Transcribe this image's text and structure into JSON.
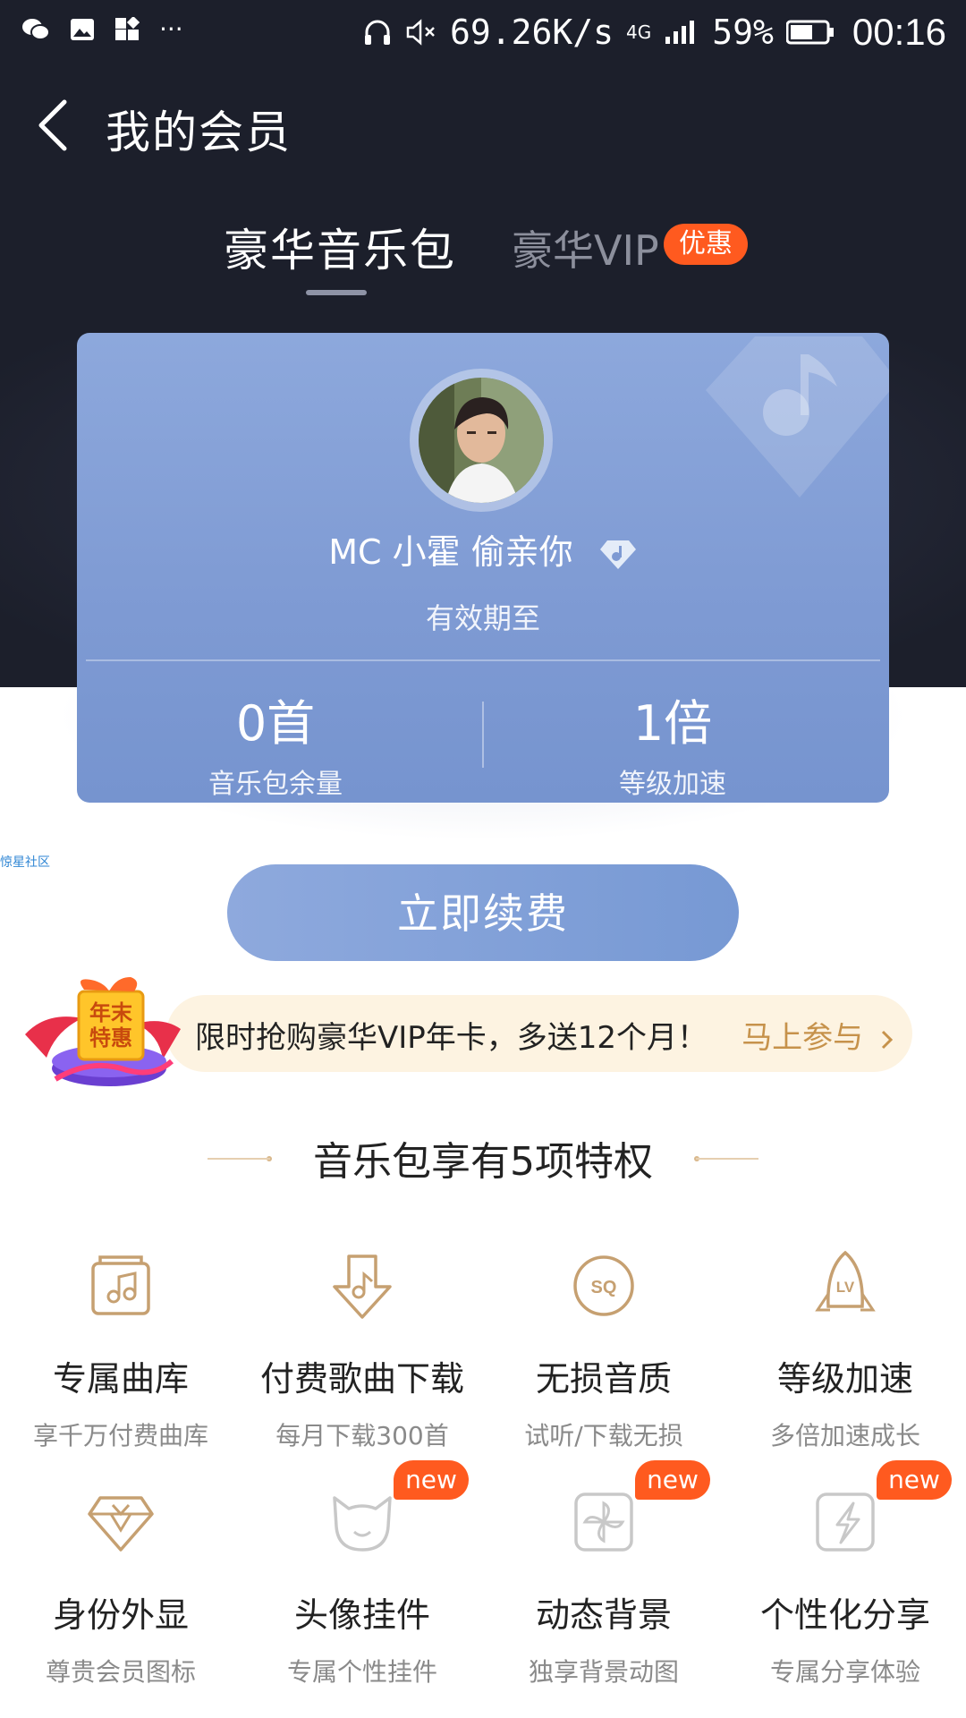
{
  "status_bar": {
    "speed": "69.26K/s",
    "network": "4G",
    "battery": "59%",
    "time": "00:16",
    "left_icons": [
      "wechat-icon",
      "gallery-icon",
      "app-icon",
      "more-icon"
    ]
  },
  "nav": {
    "title": "我的会员"
  },
  "tabs": [
    {
      "label": "豪华音乐包",
      "active": true
    },
    {
      "label": "豪华VIP",
      "badge": "优惠",
      "active": false
    }
  ],
  "card": {
    "username": "MC 小霍 偷亲你",
    "expiry_label": "有效期至",
    "stats": [
      {
        "value": "0首",
        "label": "音乐包余量"
      },
      {
        "value": "1倍",
        "label": "等级加速"
      }
    ]
  },
  "watermark": "惊星社区",
  "renew_label": "立即续费",
  "promo": {
    "badge_text": "年末特惠",
    "text": "限时抢购豪华VIP年卡，多送12个月！",
    "cta": "马上参与"
  },
  "section_title": "音乐包享有5项特权",
  "privileges": [
    {
      "name": "专属曲库",
      "desc": "享千万付费曲库",
      "icon": "music-library-icon"
    },
    {
      "name": "付费歌曲下载",
      "desc": "每月下载300首",
      "icon": "download-icon"
    },
    {
      "name": "无损音质",
      "desc": "试听/下载无损",
      "icon": "sq-icon"
    },
    {
      "name": "等级加速",
      "desc": "多倍加速成长",
      "icon": "rocket-lv-icon"
    },
    {
      "name": "身份外显",
      "desc": "尊贵会员图标",
      "icon": "diamond-icon"
    },
    {
      "name": "头像挂件",
      "desc": "专属个性挂件",
      "icon": "cat-icon",
      "badge": "new"
    },
    {
      "name": "动态背景",
      "desc": "独享背景动图",
      "icon": "pinwheel-icon",
      "badge": "new"
    },
    {
      "name": "个性化分享",
      "desc": "专属分享体验",
      "icon": "lightning-icon",
      "badge": "new"
    }
  ],
  "colors": {
    "header_bg": "#1c1f2b",
    "card": "#7e9ad3",
    "accent_orange": "#ff5a1f",
    "gold": "#c6924b"
  }
}
